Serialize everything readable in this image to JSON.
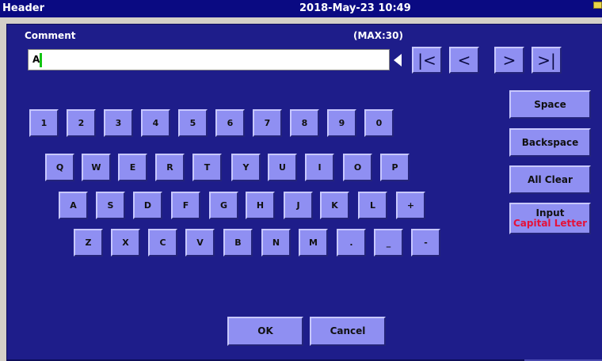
{
  "header": {
    "title": "Header",
    "datetime": "2018-May-23 10:49"
  },
  "dialog": {
    "comment_label": "Comment",
    "max_label": "(MAX:30)",
    "input_value": "A"
  },
  "nav": {
    "first": "|<",
    "prev": "<",
    "next": ">",
    "last": ">|"
  },
  "keys": {
    "row1": [
      "1",
      "2",
      "3",
      "4",
      "5",
      "6",
      "7",
      "8",
      "9",
      "0"
    ],
    "row2": [
      "Q",
      "W",
      "E",
      "R",
      "T",
      "Y",
      "U",
      "I",
      "O",
      "P"
    ],
    "row3": [
      "A",
      "S",
      "D",
      "F",
      "G",
      "H",
      "J",
      "K",
      "L",
      "+"
    ],
    "row4": [
      "Z",
      "X",
      "C",
      "V",
      "B",
      "N",
      "M",
      ".",
      "_",
      "-"
    ]
  },
  "side": {
    "space": "Space",
    "backspace": "Backspace",
    "all_clear": "All Clear",
    "input_line1": "Input",
    "input_line2": "Capital Letter"
  },
  "footer": {
    "ok": "OK",
    "cancel": "Cancel"
  },
  "colors": {
    "panel": "#1e1d8a",
    "button": "#8f8ff2",
    "caret": "#12c412",
    "mode_text": "#e4123a"
  }
}
